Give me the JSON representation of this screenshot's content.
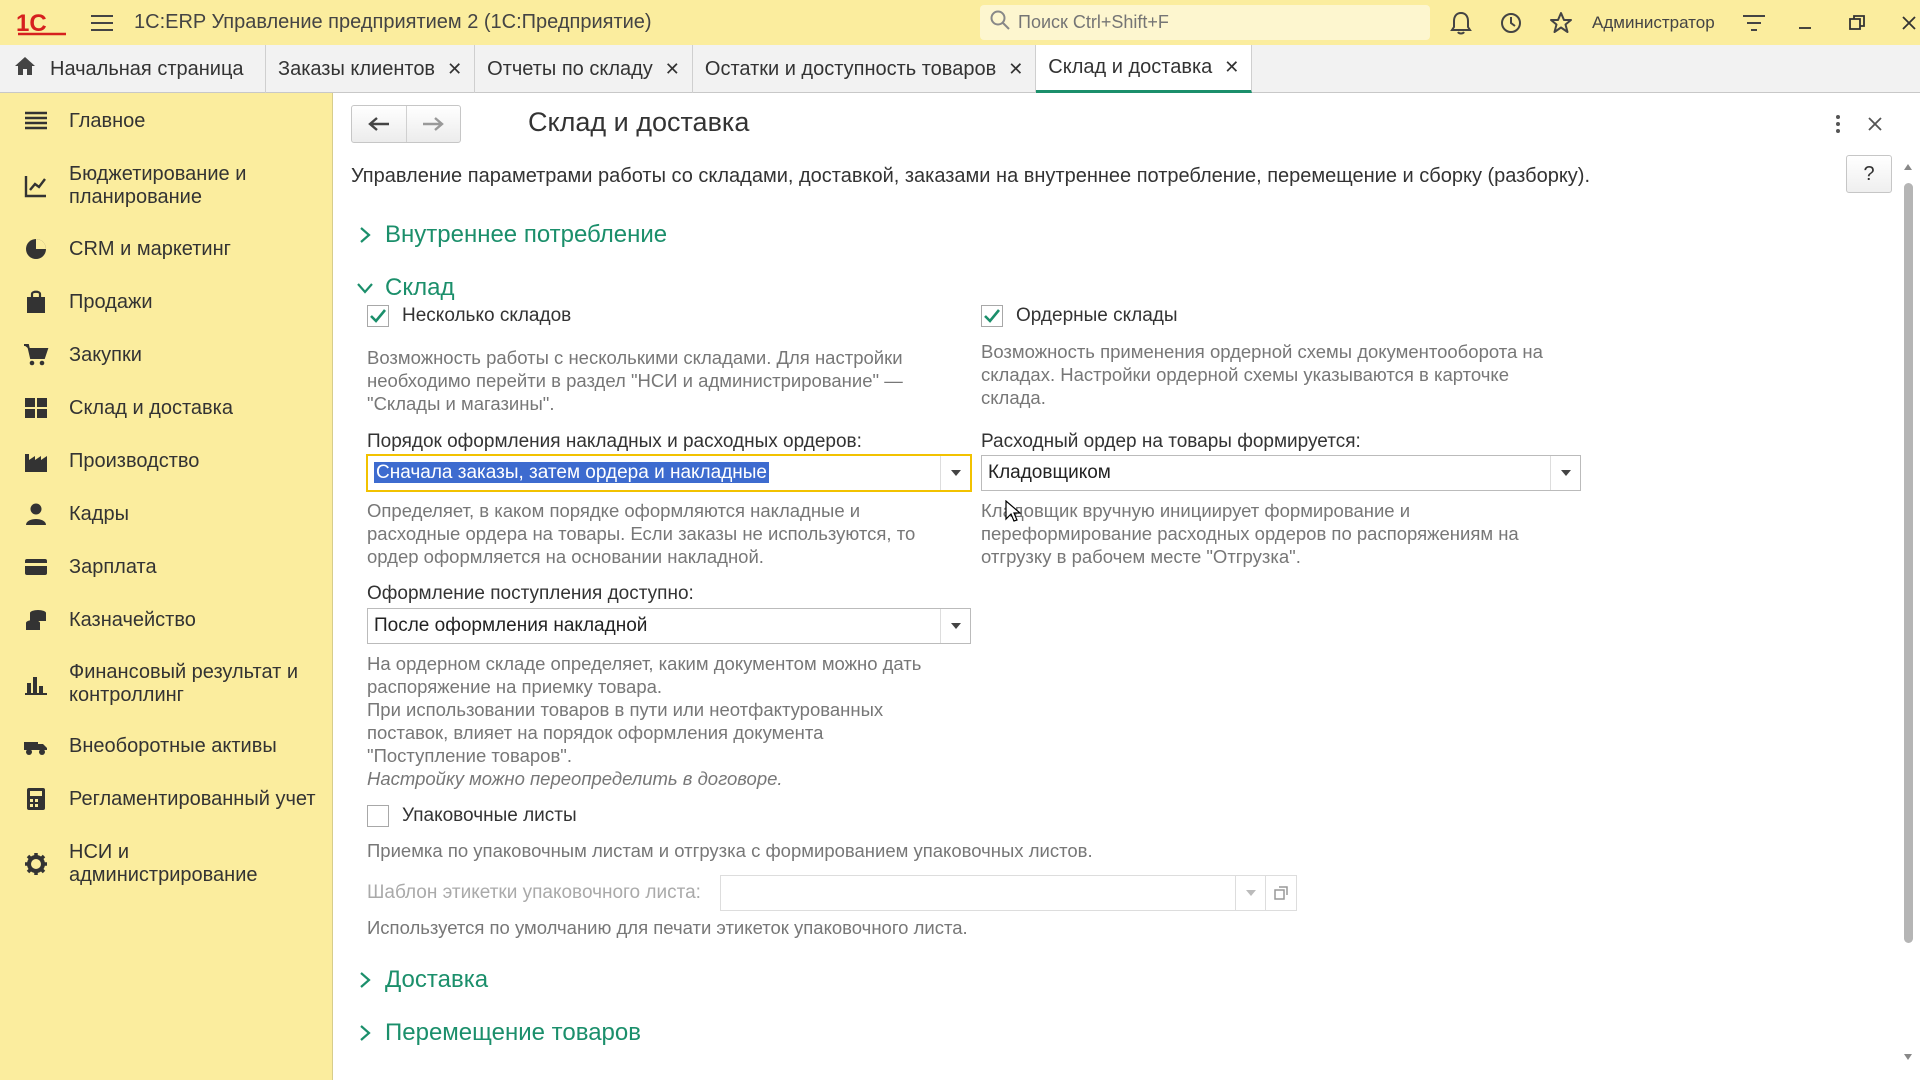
{
  "window": {
    "logo": "1С",
    "title": "1С:ERP Управление предприятием 2  (1С:Предприятие)",
    "search_placeholder": "Поиск Ctrl+Shift+F",
    "user": "Администратор"
  },
  "tabs": [
    {
      "label": "Начальная страница",
      "closable": false,
      "active": false
    },
    {
      "label": "Заказы клиентов",
      "closable": true,
      "active": false
    },
    {
      "label": "Отчеты по складу",
      "closable": true,
      "active": false
    },
    {
      "label": "Остатки и доступность товаров",
      "closable": true,
      "active": false
    },
    {
      "label": "Склад и доставка",
      "closable": true,
      "active": true
    }
  ],
  "sidebar": {
    "items": [
      {
        "label": "Главное",
        "icon": "menu-icon"
      },
      {
        "label": "Бюджетирование и\nпланирование",
        "icon": "budget-icon"
      },
      {
        "label": "CRM и маркетинг",
        "icon": "crm-icon"
      },
      {
        "label": "Продажи",
        "icon": "bag-icon"
      },
      {
        "label": "Закупки",
        "icon": "cart-icon"
      },
      {
        "label": "Склад и доставка",
        "icon": "warehouse-icon"
      },
      {
        "label": "Производство",
        "icon": "factory-icon"
      },
      {
        "label": "Кадры",
        "icon": "person-icon"
      },
      {
        "label": "Зарплата",
        "icon": "card-icon"
      },
      {
        "label": "Казначейство",
        "icon": "coins-icon"
      },
      {
        "label": "Финансовый результат и\nконтроллинг",
        "icon": "chart-icon"
      },
      {
        "label": "Внеоборотные активы",
        "icon": "truck-icon"
      },
      {
        "label": "Регламентированный учет",
        "icon": "calculator-icon"
      },
      {
        "label": "НСИ и\nадминистрирование",
        "icon": "gear-icon"
      }
    ]
  },
  "main": {
    "title": "Склад и доставка",
    "help_label": "?",
    "description": "Управление параметрами работы со складами, доставкой, заказами на внутреннее потребление, перемещение и сборку (разборку).",
    "groups": {
      "internal": "Внутреннее потребление",
      "warehouse": "Склад",
      "delivery": "Доставка",
      "transfer": "Перемещение товаров"
    },
    "multiple_warehouses": {
      "label": "Несколько складов",
      "checked": true,
      "hint": "Возможность работы с несколькими складами. Для настройки\nнеобходимо перейти в раздел \"НСИ и администрирование\" —\n\"Склады и магазины\"."
    },
    "order_warehouses": {
      "label": "Ордерные склады",
      "checked": true,
      "hint": "Возможность применения ордерной схемы документооборота на\nскладах. Настройки ордерной схемы указываются в карточке\nсклада."
    },
    "invoice_order": {
      "label": "Порядок оформления накладных и расходных ордеров:",
      "value": "Сначала заказы, затем ордера и накладные",
      "hint": "Определяет, в каком порядке оформляются накладные и\nрасходные ордера на товары. Если заказы не используются, то\nордер оформляется на основании накладной."
    },
    "expense_order": {
      "label": "Расходный ордер на товары формируется:",
      "value": "Кладовщиком",
      "hint": "Кладовщик вручную инициирует формирование и\nпереформирование расходных ордеров по распоряжениям на\nотгрузку в рабочем месте \"Отгрузка\"."
    },
    "receipt": {
      "label": "Оформление поступления доступно:",
      "value": "После оформления накладной",
      "hint": "На ордерном складе определяет, каким документом можно дать\nраспоряжение на приемку товара.\nПри использовании товаров в пути или неотфактурованных\nпоставок, влияет на порядок оформления документа\n\"Поступление товаров\".",
      "hint_italic": "Настройку можно переопределить в договоре."
    },
    "packing_lists": {
      "label": "Упаковочные листы",
      "checked": false,
      "hint": "Приемка по упаковочным листам и отгрузка с формированием упаковочных листов."
    },
    "label_template": {
      "label": "Шаблон этикетки упаковочного листа:",
      "value": "",
      "hint": "Используется по умолчанию для печати этикеток упаковочного листа."
    }
  },
  "colors": {
    "accent_green": "#1b8f6b",
    "sidebar_yellow": "#fbed9e",
    "focus_yellow": "#f2c200",
    "selection_blue": "#3d6bcf"
  }
}
